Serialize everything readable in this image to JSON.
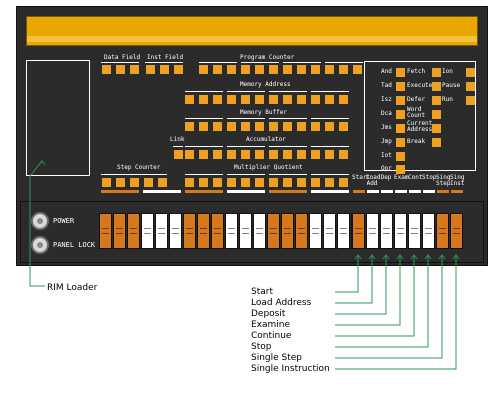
{
  "panel": {
    "register_labels": {
      "data_field": "Data Field",
      "inst_field": "Inst Field",
      "program_counter": "Program Counter",
      "memory_address": "Memory Address",
      "memory_buffer": "Memory Buffer",
      "link": "Link",
      "accumulator": "Accumulator",
      "step_counter": "Step Counter",
      "multiplier_quotient": "Multiplier Quotient"
    },
    "status": {
      "col1": [
        "And",
        "Tad",
        "Isz",
        "Dca",
        "Jms",
        "Jmp",
        "Iot",
        "Opr"
      ],
      "col2": [
        "Fetch",
        "Execute",
        "Defer",
        "Word Count",
        "Current Address",
        "Break"
      ],
      "col3": [
        "Ion",
        "Pause",
        "Run"
      ]
    },
    "power_label": "POWER",
    "panel_lock_label": "PANEL LOCK",
    "key_labels": [
      "Start",
      "Load Add",
      "Dep",
      "Exam",
      "Cont",
      "Stop",
      "Sing Step",
      "Sing Inst"
    ],
    "switch_colors": [
      "orange",
      "orange",
      "orange",
      "white",
      "white",
      "white",
      "orange",
      "orange",
      "orange",
      "white",
      "white",
      "white",
      "orange",
      "orange",
      "orange",
      "white",
      "white",
      "white",
      "white",
      "orange",
      "white",
      "white",
      "white",
      "white",
      "white",
      "orange",
      "orange"
    ]
  },
  "annotations": {
    "rim_loader": "RIM Loader",
    "keys": [
      "Start",
      "Load Address",
      "Deposit",
      "Examine",
      "Continue",
      "Stop",
      "Single Step",
      "Single Instruction"
    ]
  },
  "colors": {
    "panel": "#2b2b2b",
    "lamp": "#f0a020",
    "stripe": "#e8a800",
    "switch_orange": "#d5781e",
    "annotation_line": "#2a9a5a"
  }
}
